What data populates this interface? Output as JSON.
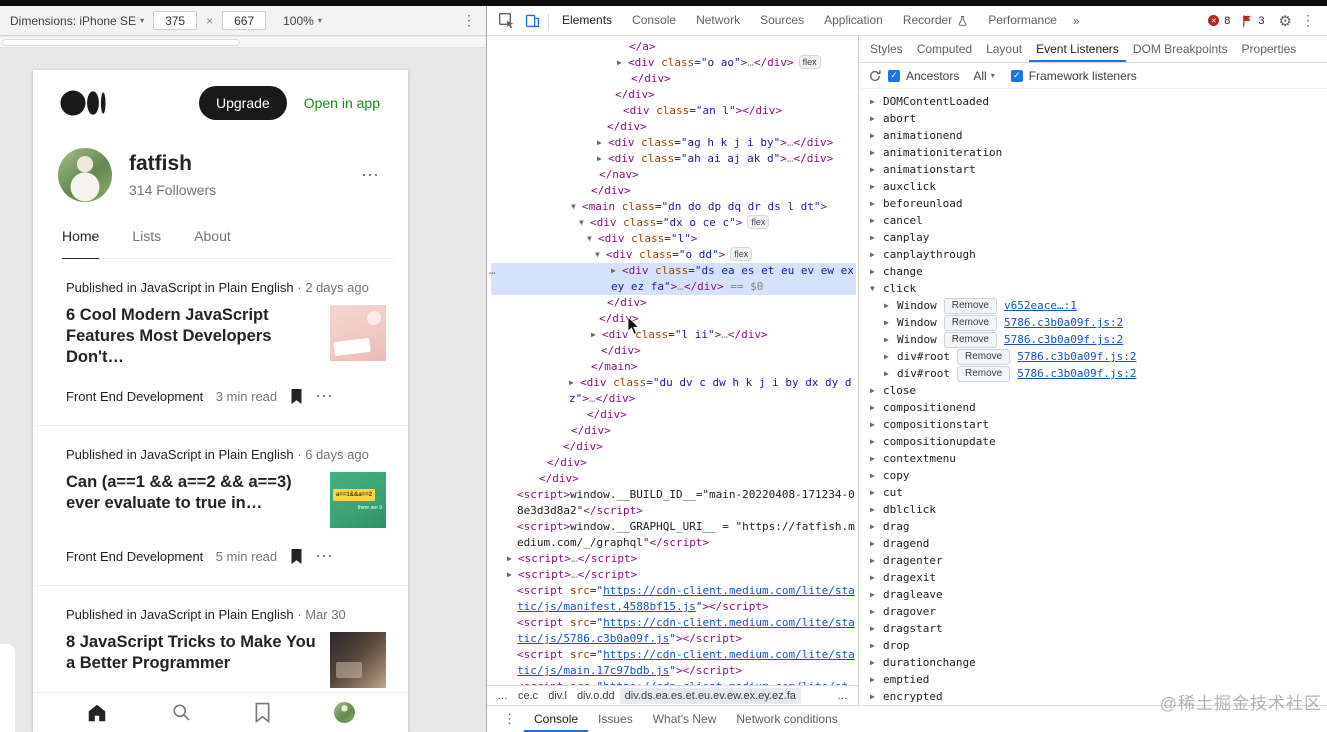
{
  "watermark": "@稀土掘金技术社区",
  "icons": {
    "kebab_h": "⋯",
    "kebab_v": "⋮",
    "gear": "⚙",
    "caret": "▾",
    "check": "✓",
    "arrow_closed": "▶",
    "arrow_open": "▼",
    "more": "»",
    "times": "×",
    "error_x": "✕"
  },
  "device_toolbar": {
    "dimensions_label": "Dimensions: iPhone SE",
    "width_value": "375",
    "height_value": "667",
    "zoom_value": "100%"
  },
  "medium": {
    "header": {
      "upgrade_label": "Upgrade",
      "open_in_app_label": "Open in app"
    },
    "profile": {
      "name": "fatfish",
      "followers": "314 Followers"
    },
    "tabs": {
      "home": "Home",
      "lists": "Lists",
      "about": "About"
    },
    "articles": [
      {
        "published_prefix": "Published in ",
        "publication": "JavaScript in Plain English",
        "separator": " · ",
        "date": "2 days ago",
        "title": "6 Cool Modern JavaScript Features Most Developers Don't…",
        "tag": "Front End Development",
        "read_time": "3 min read"
      },
      {
        "published_prefix": "Published in ",
        "publication": "JavaScript in Plain English",
        "separator": " · ",
        "date": "6 days ago",
        "title": "Can (a==1 && a==2 && a==3) ever evaluate to true in…",
        "tag": "Front End Development",
        "read_time": "5 min read",
        "thumb_text": "a==1&&a==2",
        "thumb_subtext": "there are 9"
      },
      {
        "published_prefix": "Published in ",
        "publication": "JavaScript in Plain English",
        "separator": " · ",
        "date": "Mar 30",
        "title": "8 JavaScript Tricks to Make You a Better Programmer"
      }
    ]
  },
  "devtools": {
    "toolbar": {
      "tabs": [
        "Elements",
        "Console",
        "Network",
        "Sources",
        "Application",
        "Recorder",
        "Performance"
      ],
      "active_tab": "Elements",
      "more": "»",
      "error_count": "8",
      "issue_count": "3"
    },
    "elements": {
      "hover_dots": "…",
      "tree": [
        {
          "i": 138,
          "tk": [
            [
              "t",
              "</a>"
            ]
          ]
        },
        {
          "i": 126,
          "tk": [
            [
              "a",
              "▶"
            ],
            [
              "t",
              "<div"
            ],
            [
              "p",
              " "
            ],
            [
              "n",
              "class"
            ],
            [
              "p",
              "="
            ],
            [
              "v",
              "\"o ao\""
            ],
            [
              "t",
              ">"
            ],
            [
              "g",
              "…"
            ],
            [
              "t",
              "</div>"
            ],
            [
              "b",
              "flex"
            ]
          ]
        },
        {
          "i": 140,
          "tk": [
            [
              "t",
              "</div>"
            ]
          ]
        },
        {
          "i": 124,
          "tk": [
            [
              "t",
              "</div>"
            ]
          ]
        },
        {
          "i": 132,
          "tk": [
            [
              "t",
              "<div"
            ],
            [
              "p",
              " "
            ],
            [
              "n",
              "class"
            ],
            [
              "p",
              "="
            ],
            [
              "v",
              "\"an l\""
            ],
            [
              "t",
              "></div>"
            ]
          ]
        },
        {
          "i": 116,
          "tk": [
            [
              "t",
              "</div>"
            ]
          ]
        },
        {
          "i": 106,
          "tk": [
            [
              "a",
              "▶"
            ],
            [
              "t",
              "<div"
            ],
            [
              "p",
              " "
            ],
            [
              "n",
              "class"
            ],
            [
              "p",
              "="
            ],
            [
              "v",
              "\"ag h k j i by\""
            ],
            [
              "t",
              ">"
            ],
            [
              "g",
              "…"
            ],
            [
              "t",
              "</div>"
            ]
          ]
        },
        {
          "i": 106,
          "tk": [
            [
              "a",
              "▶"
            ],
            [
              "t",
              "<div"
            ],
            [
              "p",
              " "
            ],
            [
              "n",
              "class"
            ],
            [
              "p",
              "="
            ],
            [
              "v",
              "\"ah ai aj ak d\""
            ],
            [
              "t",
              ">"
            ],
            [
              "g",
              "…"
            ],
            [
              "t",
              "</div>"
            ]
          ]
        },
        {
          "i": 108,
          "tk": [
            [
              "t",
              "</nav>"
            ]
          ]
        },
        {
          "i": 100,
          "tk": [
            [
              "t",
              "</div>"
            ]
          ]
        },
        {
          "i": 80,
          "tk": [
            [
              "a",
              "▼"
            ],
            [
              "t",
              "<main"
            ],
            [
              "p",
              " "
            ],
            [
              "n",
              "class"
            ],
            [
              "p",
              "="
            ],
            [
              "v",
              "\"dn do dp dq dr ds l dt\""
            ],
            [
              "t",
              ">"
            ]
          ]
        },
        {
          "i": 88,
          "tk": [
            [
              "a",
              "▼"
            ],
            [
              "t",
              "<div"
            ],
            [
              "p",
              " "
            ],
            [
              "n",
              "class"
            ],
            [
              "p",
              "="
            ],
            [
              "v",
              "\"dx o ce c\""
            ],
            [
              "t",
              ">"
            ],
            [
              "b",
              "flex"
            ]
          ]
        },
        {
          "i": 96,
          "tk": [
            [
              "a",
              "▼"
            ],
            [
              "t",
              "<div"
            ],
            [
              "p",
              " "
            ],
            [
              "n",
              "class"
            ],
            [
              "p",
              "="
            ],
            [
              "v",
              "\"l\""
            ],
            [
              "t",
              ">"
            ]
          ]
        },
        {
          "i": 104,
          "tk": [
            [
              "a",
              "▼"
            ],
            [
              "t",
              "<div"
            ],
            [
              "p",
              " "
            ],
            [
              "n",
              "class"
            ],
            [
              "p",
              "="
            ],
            [
              "v",
              "\"o dd\""
            ],
            [
              "t",
              ">"
            ],
            [
              "b",
              "flex"
            ]
          ]
        },
        {
          "i": 120,
          "hl": 1,
          "tk": [
            [
              "a",
              "▶"
            ],
            [
              "t",
              "<div"
            ],
            [
              "p",
              " "
            ],
            [
              "n",
              "class"
            ],
            [
              "p",
              "="
            ],
            [
              "v",
              "\"ds ea es et eu ev ew ex ey ez fa\""
            ],
            [
              "t",
              ">"
            ],
            [
              "g",
              "…"
            ],
            [
              "t",
              "</div>"
            ],
            [
              "m",
              " == $0"
            ]
          ]
        },
        {
          "i": 116,
          "tk": [
            [
              "t",
              "</div>"
            ]
          ]
        },
        {
          "i": 108,
          "tk": [
            [
              "t",
              "</div>"
            ]
          ]
        },
        {
          "i": 100,
          "tk": [
            [
              "a",
              "▶"
            ],
            [
              "t",
              "<div"
            ],
            [
              "p",
              " "
            ],
            [
              "n",
              "class"
            ],
            [
              "p",
              "="
            ],
            [
              "v",
              "\"l ii\""
            ],
            [
              "t",
              ">"
            ],
            [
              "g",
              "…"
            ],
            [
              "t",
              "</div>"
            ]
          ]
        },
        {
          "i": 110,
          "tk": [
            [
              "t",
              "</div>"
            ]
          ]
        },
        {
          "i": 100,
          "tk": [
            [
              "t",
              "</main>"
            ]
          ]
        },
        {
          "i": 78,
          "tk": [
            [
              "a",
              "▶"
            ],
            [
              "t",
              "<div"
            ],
            [
              "p",
              " "
            ],
            [
              "n",
              "class"
            ],
            [
              "p",
              "="
            ],
            [
              "v",
              "\"du dv c dw h k j i by dx dy d z\""
            ],
            [
              "t",
              ">"
            ],
            [
              "g",
              "…"
            ],
            [
              "t",
              "</div>"
            ]
          ]
        },
        {
          "i": 96,
          "tk": [
            [
              "t",
              "</div>"
            ]
          ]
        },
        {
          "i": 80,
          "tk": [
            [
              "t",
              "</div>"
            ]
          ]
        },
        {
          "i": 72,
          "tk": [
            [
              "t",
              "</div>"
            ]
          ]
        },
        {
          "i": 56,
          "tk": [
            [
              "t",
              "</div>"
            ]
          ]
        },
        {
          "i": 48,
          "tk": [
            [
              "t",
              "</div>"
            ]
          ]
        },
        {
          "i": 26,
          "tk": [
            [
              "t",
              "<script>"
            ],
            [
              "p",
              "window.__BUILD_ID__=\"main-20220408-171234-08e3d3d8a2\""
            ],
            [
              "t",
              "</script>"
            ]
          ]
        },
        {
          "i": 26,
          "tk": [
            [
              "t",
              "<script>"
            ],
            [
              "p",
              "window.__GRAPHQL_URI__ = \"https://fatfish.medium.com/_/graphql\""
            ],
            [
              "t",
              "</script>"
            ]
          ]
        },
        {
          "i": 16,
          "tk": [
            [
              "a",
              "▶"
            ],
            [
              "t",
              "<script>"
            ],
            [
              "g",
              "…"
            ],
            [
              "t",
              "</script>"
            ]
          ]
        },
        {
          "i": 16,
          "tk": [
            [
              "a",
              "▶"
            ],
            [
              "t",
              "<script>"
            ],
            [
              "g",
              "…"
            ],
            [
              "t",
              "</script>"
            ]
          ]
        },
        {
          "i": 26,
          "tk": [
            [
              "t",
              "<script"
            ],
            [
              "p",
              " "
            ],
            [
              "n",
              "src"
            ],
            [
              "p",
              "="
            ],
            [
              "v",
              "\""
            ],
            [
              "l",
              "https://cdn-client.medium.com/lite/static/js/manifest.4588bf15.js"
            ],
            [
              "v",
              "\""
            ],
            [
              "t",
              "></script>"
            ]
          ]
        },
        {
          "i": 26,
          "tk": [
            [
              "t",
              "<script"
            ],
            [
              "p",
              " "
            ],
            [
              "n",
              "src"
            ],
            [
              "p",
              "="
            ],
            [
              "v",
              "\""
            ],
            [
              "l",
              "https://cdn-client.medium.com/lite/static/js/5786.c3b0a09f.js"
            ],
            [
              "v",
              "\""
            ],
            [
              "t",
              "></script>"
            ]
          ]
        },
        {
          "i": 26,
          "tk": [
            [
              "t",
              "<script"
            ],
            [
              "p",
              " "
            ],
            [
              "n",
              "src"
            ],
            [
              "p",
              "="
            ],
            [
              "v",
              "\""
            ],
            [
              "l",
              "https://cdn-client.medium.com/lite/static/js/main.17c97bdb.js"
            ],
            [
              "v",
              "\""
            ],
            [
              "t",
              "></script>"
            ]
          ]
        },
        {
          "i": 26,
          "tk": [
            [
              "t",
              "<script"
            ],
            [
              "p",
              " "
            ],
            [
              "n",
              "src"
            ],
            [
              "p",
              "="
            ],
            [
              "v",
              "\""
            ],
            [
              "l",
              "https://cdn-client.medium.com/lite/st"
            ]
          ]
        }
      ],
      "breadcrumbs": [
        "…",
        "ce.c",
        "div.l",
        "div.o.dd",
        "div.ds.ea.es.et.eu.ev.ew.ex.ey.ez.fa",
        "…"
      ]
    },
    "sidebar": {
      "tabs": [
        "Styles",
        "Computed",
        "Layout",
        "Event Listeners",
        "DOM Breakpoints",
        "Properties"
      ],
      "active_tab": "Event Listeners",
      "toolbar": {
        "ancestors": "Ancestors",
        "filter": "All",
        "framework": "Framework listeners"
      },
      "events_before": [
        "DOMContentLoaded",
        "abort",
        "animationend",
        "animationiteration",
        "animationstart",
        "auxclick",
        "beforeunload",
        "cancel",
        "canplay",
        "canplaythrough",
        "change"
      ],
      "expanded_event": "click",
      "remove_label": "Remove",
      "click_listeners": [
        {
          "node": "Window",
          "source": "v652eace…:1"
        },
        {
          "node": "Window",
          "source": "5786.c3b0a09f.js:2"
        },
        {
          "node": "Window",
          "source": "5786.c3b0a09f.js:2"
        },
        {
          "node": "div#root",
          "source": "5786.c3b0a09f.js:2"
        },
        {
          "node": "div#root",
          "source": "5786.c3b0a09f.js:2"
        }
      ],
      "events_after": [
        "close",
        "compositionend",
        "compositionstart",
        "compositionupdate",
        "contextmenu",
        "copy",
        "cut",
        "dblclick",
        "drag",
        "dragend",
        "dragenter",
        "dragexit",
        "dragleave",
        "dragover",
        "dragstart",
        "drop",
        "durationchange",
        "emptied",
        "encrypted"
      ]
    },
    "drawer": {
      "tabs": [
        "Console",
        "Issues",
        "What's New",
        "Network conditions"
      ],
      "active_tab": "Console"
    }
  },
  "colors": {
    "accent_blue": "#1a73e8",
    "medium_green": "#1a8917",
    "error_red": "#b3261e",
    "highlight_blue": "#d6e2fb"
  }
}
